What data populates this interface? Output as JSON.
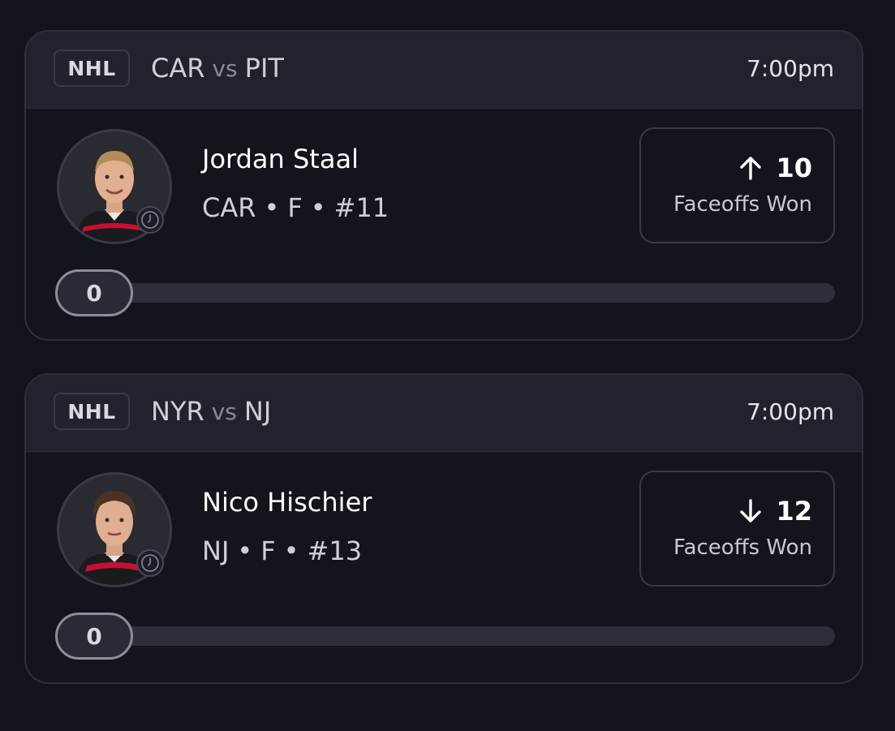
{
  "cards": [
    {
      "league": "NHL",
      "matchup": {
        "home": "CAR",
        "vs": "vs",
        "away": "PIT"
      },
      "time": "7:00pm",
      "player": {
        "name": "Jordan Staal",
        "team": "CAR",
        "position": "F",
        "number": "#11",
        "separator": "•",
        "avatar_icon": "player-headshot",
        "status_icon": "clock-icon"
      },
      "stat": {
        "direction": "up",
        "direction_icon": "arrow-up-icon",
        "line": "10",
        "label": "Faceoffs Won"
      },
      "progress": {
        "value": "0",
        "fraction": 0
      }
    },
    {
      "league": "NHL",
      "matchup": {
        "home": "NYR",
        "vs": "vs",
        "away": "NJ"
      },
      "time": "7:00pm",
      "player": {
        "name": "Nico Hischier",
        "team": "NJ",
        "position": "F",
        "number": "#13",
        "separator": "•",
        "avatar_icon": "player-headshot",
        "status_icon": "clock-icon"
      },
      "stat": {
        "direction": "down",
        "direction_icon": "arrow-down-icon",
        "line": "12",
        "label": "Faceoffs Won"
      },
      "progress": {
        "value": "0",
        "fraction": 0
      }
    }
  ],
  "colors": {
    "background": "#13131c",
    "card_header": "#22222c",
    "border": "#2f2f3b",
    "jersey_red": "#c8102e"
  }
}
